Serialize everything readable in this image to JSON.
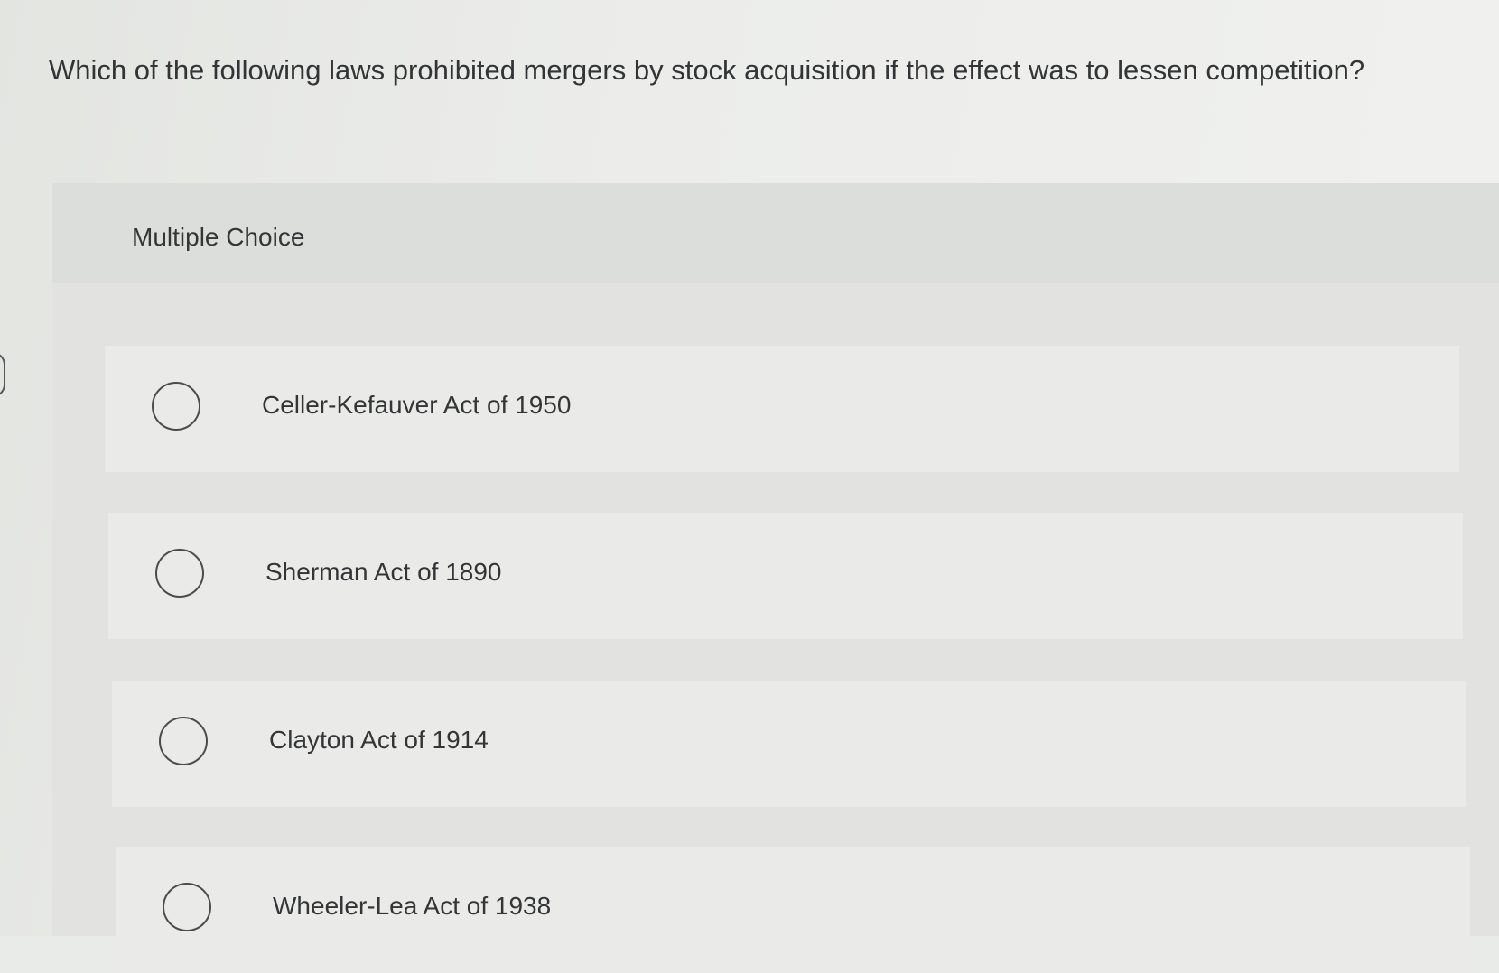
{
  "question": {
    "text": "Which of the following laws prohibited mergers by stock acquisition if the effect was to lessen competition?"
  },
  "multiple_choice": {
    "label": "Multiple Choice",
    "options": [
      {
        "label": "Celler-Kefauver Act of 1950",
        "selected": false
      },
      {
        "label": "Sherman Act of 1890",
        "selected": false
      },
      {
        "label": "Clayton Act of 1914",
        "selected": false
      },
      {
        "label": "Wheeler-Lea Act of 1938",
        "selected": false
      }
    ]
  }
}
